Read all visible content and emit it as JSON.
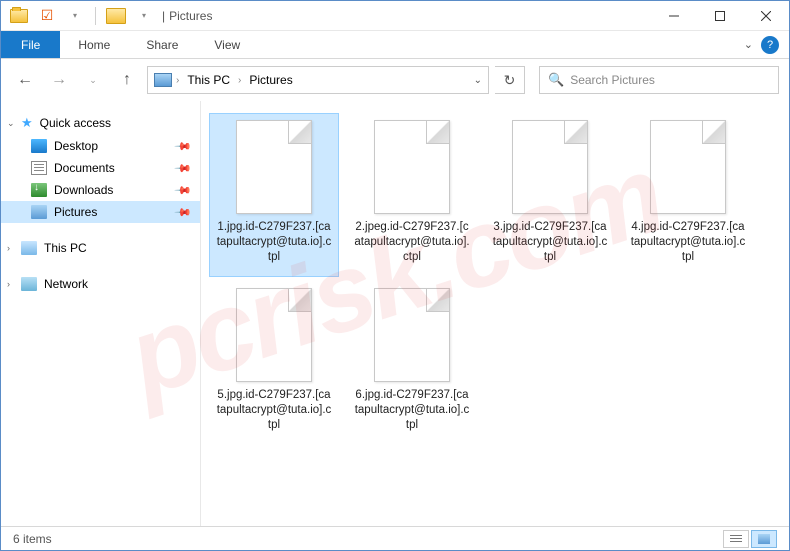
{
  "window": {
    "title_sep": "|",
    "title": "Pictures"
  },
  "ribbon": {
    "file": "File",
    "home": "Home",
    "share": "Share",
    "view": "View"
  },
  "breadcrumb": {
    "root": "This PC",
    "current": "Pictures"
  },
  "search": {
    "placeholder": "Search Pictures"
  },
  "sidebar": {
    "quick_access": "Quick access",
    "desktop": "Desktop",
    "documents": "Documents",
    "downloads": "Downloads",
    "pictures": "Pictures",
    "this_pc": "This PC",
    "network": "Network"
  },
  "files": [
    {
      "name": "1.jpg.id-C279F237.[catapultacrypt@tuta.io].ctpl"
    },
    {
      "name": "2.jpeg.id-C279F237.[catapultacrypt@tuta.io].ctpl"
    },
    {
      "name": "3.jpg.id-C279F237.[catapultacrypt@tuta.io].ctpl"
    },
    {
      "name": "4.jpg.id-C279F237.[catapultacrypt@tuta.io].ctpl"
    },
    {
      "name": "5.jpg.id-C279F237.[catapultacrypt@tuta.io].ctpl"
    },
    {
      "name": "6.jpg.id-C279F237.[catapultacrypt@tuta.io].ctpl"
    }
  ],
  "status": {
    "count": "6 items"
  },
  "watermark": "pcrisk.com"
}
